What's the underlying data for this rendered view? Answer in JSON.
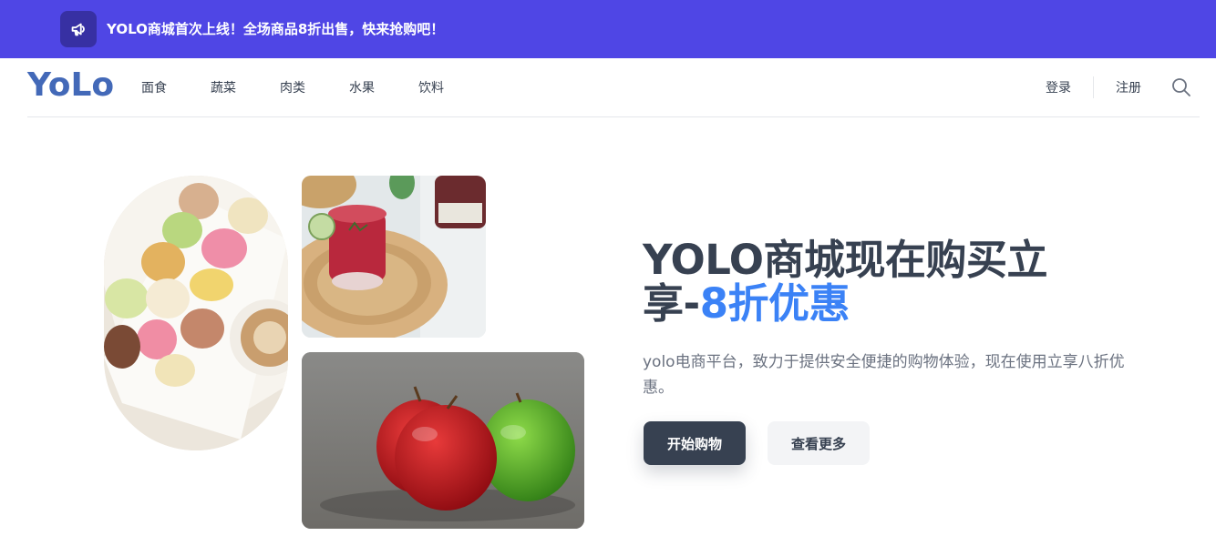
{
  "announcement": {
    "icon": "megaphone-icon",
    "text": "YOLO商城首次上线！全场商品8折出售，快来抢购吧！",
    "background": "#4f46e5"
  },
  "nav": {
    "logo": "YoLo",
    "links": [
      "面食",
      "蔬菜",
      "肉类",
      "水果",
      "饮料"
    ],
    "login": "登录",
    "register": "注册",
    "search_icon": "search-icon"
  },
  "hero": {
    "title_main": "YOLO商城现在购买立享-",
    "title_accent": "8折优惠",
    "description": "yolo电商平台，致力于提供安全便捷的购物体验，现在使用立享八折优惠。",
    "primary_button": "开始购物",
    "secondary_button": "查看更多",
    "accent_color": "#3b82f6"
  },
  "images": {
    "left": "macarons-coffee-image",
    "top_right": "red-drink-image",
    "bottom_right": "apples-image"
  }
}
